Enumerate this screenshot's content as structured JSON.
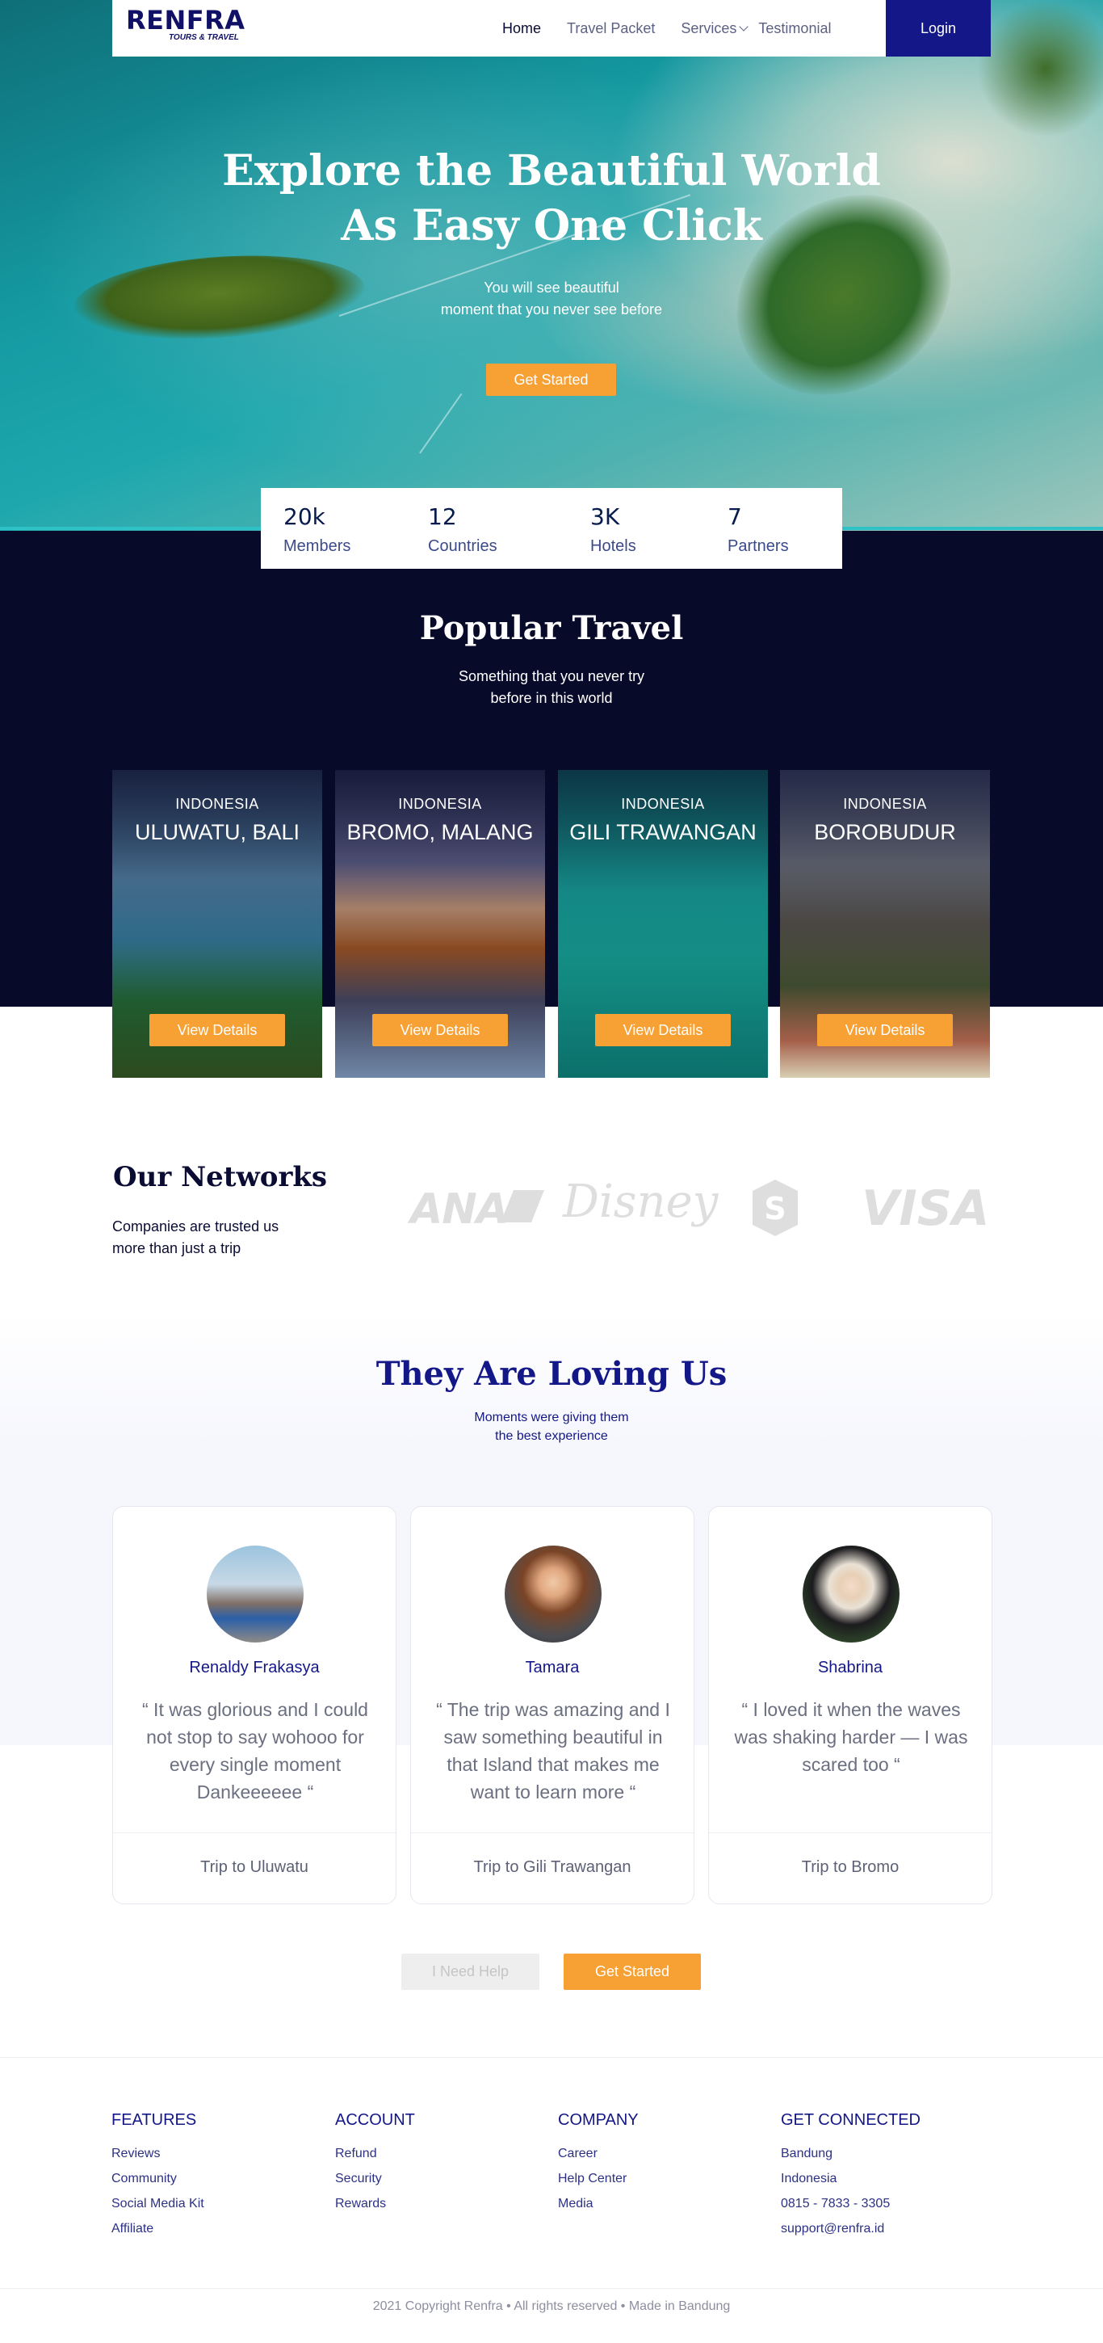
{
  "nav": {
    "logo": "RENFRA",
    "tagline": "TOURS & TRAVEL",
    "links": [
      "Home",
      "Travel Packet",
      "Services",
      "Testimonial"
    ],
    "login": "Login"
  },
  "hero": {
    "title_line1": "Explore the Beautiful World",
    "title_line2": "As Easy One Click",
    "sub_line1": "You will see beautiful",
    "sub_line2": "moment that you never see before",
    "cta": "Get Started"
  },
  "stats": [
    {
      "value": "20k",
      "label": "Members"
    },
    {
      "value": "12",
      "label": "Countries"
    },
    {
      "value": "3K",
      "label": "Hotels"
    },
    {
      "value": "7",
      "label": "Partners"
    }
  ],
  "popular": {
    "title": "Popular Travel",
    "sub_line1": "Something that you never try",
    "sub_line2": "before in this world",
    "cards": [
      {
        "country": "INDONESIA",
        "name": "ULUWATU, BALI",
        "button": "View Details"
      },
      {
        "country": "INDONESIA",
        "name": "BROMO, MALANG",
        "button": "View Details"
      },
      {
        "country": "INDONESIA",
        "name": "GILI TRAWANGAN",
        "button": "View Details"
      },
      {
        "country": "INDONESIA",
        "name": "BOROBUDUR",
        "button": "View Details"
      }
    ]
  },
  "networks": {
    "title": "Our Networks",
    "sub_line1": "Companies are trusted us",
    "sub_line2": "more than just a trip",
    "logos": [
      "ANA",
      "Disney",
      "S",
      "VISA"
    ]
  },
  "testimonials": {
    "title": "They Are Loving Us",
    "sub_line1": "Moments were giving them",
    "sub_line2": "the best experience",
    "items": [
      {
        "name": "Renaldy Frakasya",
        "quote": "“ It was glorious and I could not stop to say wohooo for every single moment Dankeeeeee “",
        "trip": "Trip to Uluwatu"
      },
      {
        "name": "Tamara",
        "quote": "“ The trip was amazing and I saw something beautiful in that Island that makes me want to learn more “",
        "trip": "Trip to Gili Trawangan"
      },
      {
        "name": "Shabrina",
        "quote": "“ I loved it when the waves was shaking harder — I was scared too “",
        "trip": "Trip to Bromo"
      }
    ],
    "help_button": "I Need Help",
    "start_button": "Get Started"
  },
  "footer": {
    "columns": [
      {
        "heading": "FEATURES",
        "links": [
          "Reviews",
          "Community",
          "Social Media Kit",
          "Affiliate"
        ]
      },
      {
        "heading": "ACCOUNT",
        "links": [
          "Refund",
          "Security",
          "Rewards"
        ]
      },
      {
        "heading": "COMPANY",
        "links": [
          "Career",
          "Help Center",
          "Media"
        ]
      },
      {
        "heading": "GET CONNECTED",
        "links": [
          "Bandung",
          "Indonesia",
          "0815 - 7833 - 3305",
          "support@renfra.id"
        ]
      }
    ],
    "copyright": "2021 Copyright Renfra • All rights reserved • Made in Bandung"
  },
  "colors": {
    "brand_navy": "#141787",
    "accent_orange": "#f7a034",
    "dark_band": "#080a29",
    "hero_teal": "#1ea8ae"
  },
  "icons": [
    "chevron-down-icon"
  ]
}
